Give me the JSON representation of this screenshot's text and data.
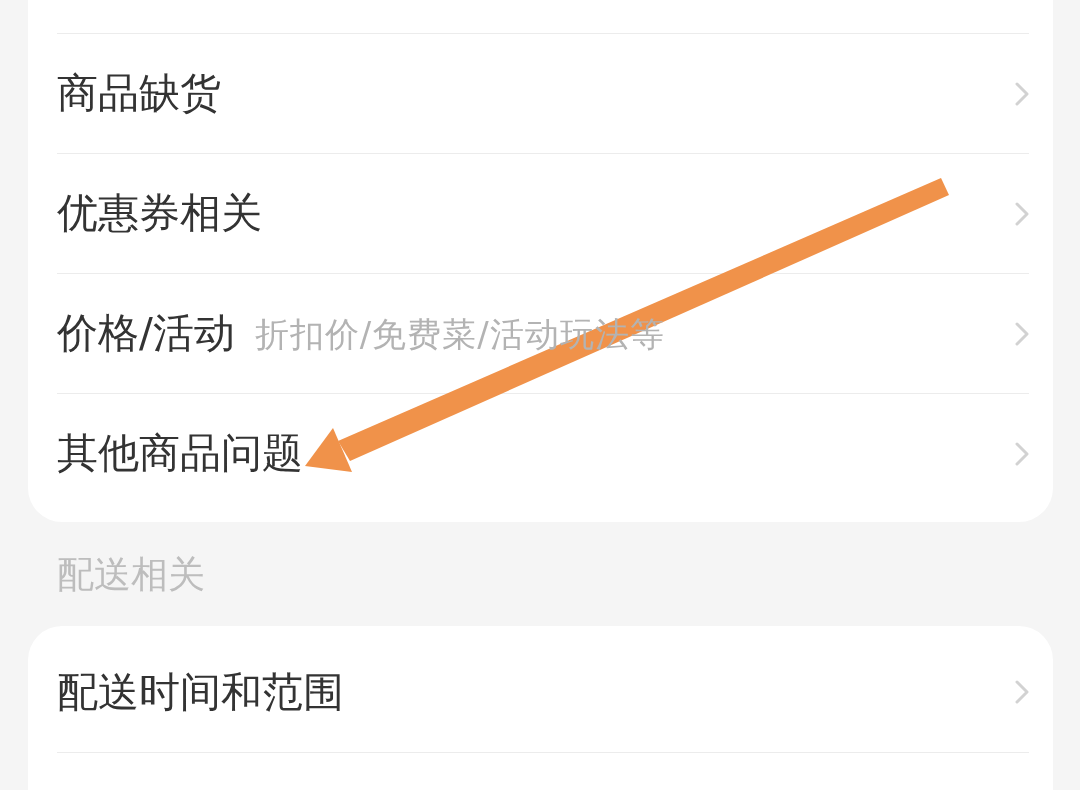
{
  "sections": [
    {
      "items": [
        {
          "label": "商品缺货"
        },
        {
          "label": "优惠券相关"
        },
        {
          "label": "价格/活动",
          "hint": "折扣价/免费菜/活动玩法等"
        },
        {
          "label": "其他商品问题"
        }
      ]
    },
    {
      "title": "配送相关",
      "items": [
        {
          "label": "配送时间和范围"
        }
      ]
    }
  ]
}
